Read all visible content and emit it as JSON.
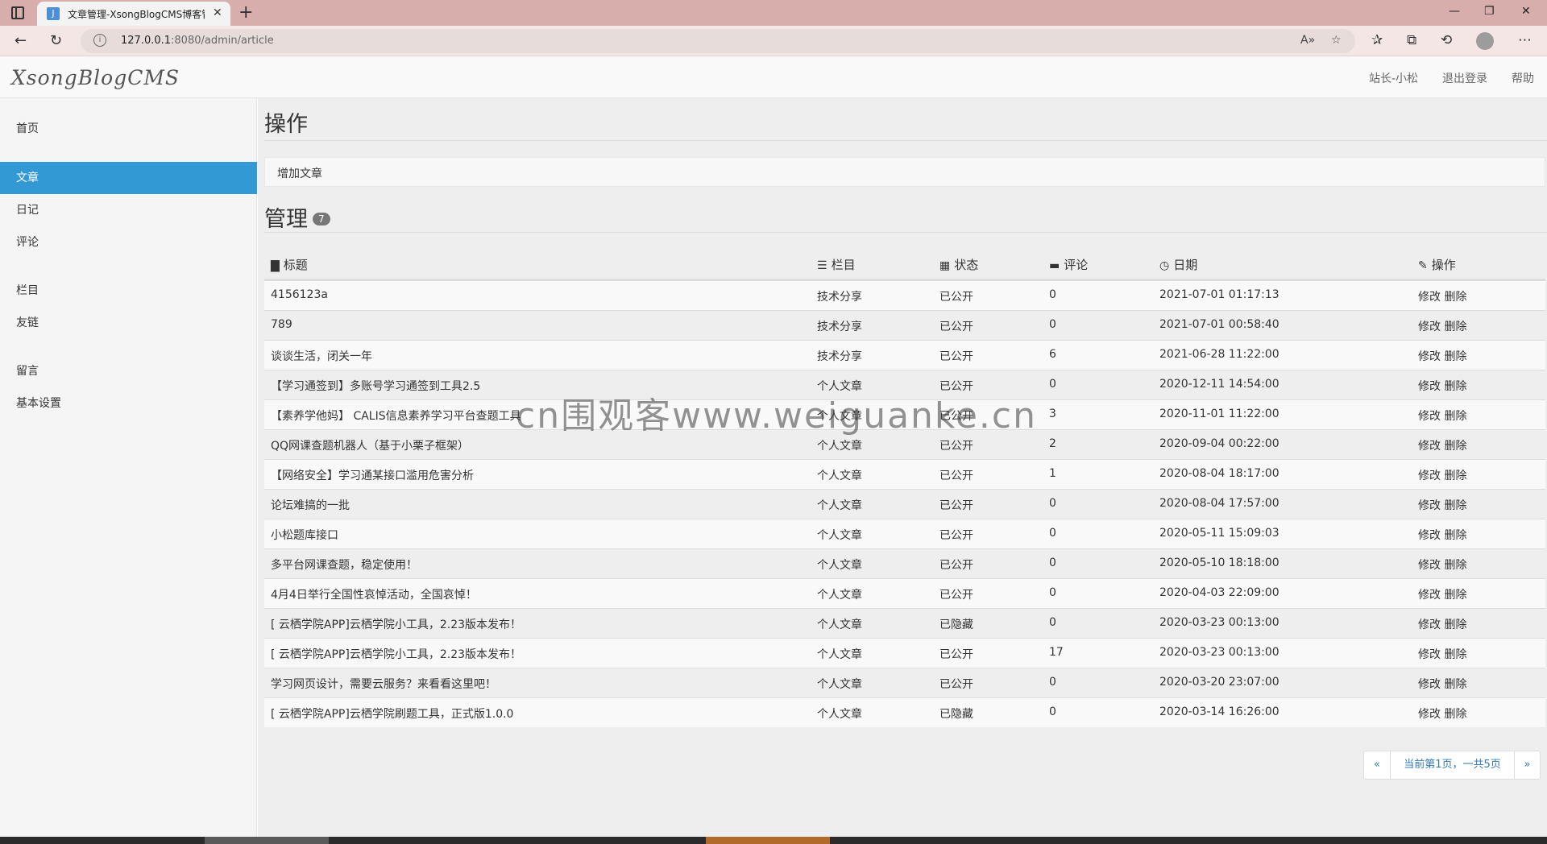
{
  "browser": {
    "tab_title": "文章管理-XsongBlogCMS博客管",
    "favicon_text": "J",
    "url_host": "127.0.0.1",
    "url_rest": ":8080/admin/article"
  },
  "app": {
    "brand": "XsongBlogCMS",
    "user_link": "站长-小松",
    "logout_link": "退出登录",
    "help_link": "帮助"
  },
  "sidebar": {
    "items": [
      {
        "label": "首页"
      },
      {
        "label": "文章",
        "active": true
      },
      {
        "label": "日记"
      },
      {
        "label": "评论"
      },
      {
        "label": "栏目"
      },
      {
        "label": "友链"
      },
      {
        "label": "留言"
      },
      {
        "label": "基本设置"
      }
    ]
  },
  "main": {
    "ops_title": "操作",
    "add_article": "增加文章",
    "manage_title": "管理",
    "manage_count": "7",
    "columns": {
      "title": "标题",
      "category": "栏目",
      "status": "状态",
      "comments": "评论",
      "date": "日期",
      "actions": "操作"
    },
    "edit_label": "修改",
    "delete_label": "删除",
    "rows": [
      {
        "title": "4156123a",
        "category": "技术分享",
        "status": "已公开",
        "comments": "0",
        "date": "2021-07-01 01:17:13"
      },
      {
        "title": "789",
        "category": "技术分享",
        "status": "已公开",
        "comments": "0",
        "date": "2021-07-01 00:58:40"
      },
      {
        "title": "谈谈生活，闭关一年",
        "category": "技术分享",
        "status": "已公开",
        "comments": "6",
        "date": "2021-06-28 11:22:00"
      },
      {
        "title": "【学习通签到】多账号学习通签到工具2.5",
        "category": "个人文章",
        "status": "已公开",
        "comments": "0",
        "date": "2020-12-11 14:54:00"
      },
      {
        "title": "【素养学他妈】 CALIS信息素养学习平台查题工具",
        "category": "个人文章",
        "status": "已公开",
        "comments": "3",
        "date": "2020-11-01 11:22:00"
      },
      {
        "title": "QQ网课查题机器人（基于小栗子框架）",
        "category": "个人文章",
        "status": "已公开",
        "comments": "2",
        "date": "2020-09-04 00:22:00"
      },
      {
        "title": "【网络安全】学习通某接口滥用危害分析",
        "category": "个人文章",
        "status": "已公开",
        "comments": "1",
        "date": "2020-08-04 18:17:00"
      },
      {
        "title": "论坛难搞的一批",
        "category": "个人文章",
        "status": "已公开",
        "comments": "0",
        "date": "2020-08-04 17:57:00"
      },
      {
        "title": "小松题库接口",
        "category": "个人文章",
        "status": "已公开",
        "comments": "0",
        "date": "2020-05-11 15:09:03"
      },
      {
        "title": "多平台网课查题，稳定使用！",
        "category": "个人文章",
        "status": "已公开",
        "comments": "0",
        "date": "2020-05-10 18:18:00"
      },
      {
        "title": "4月4日举行全国性哀悼活动，全国哀悼！",
        "category": "个人文章",
        "status": "已公开",
        "comments": "0",
        "date": "2020-04-03 22:09:00"
      },
      {
        "title": "[ 云栖学院APP]云栖学院小工具，2.23版本发布！",
        "category": "个人文章",
        "status": "已隐藏",
        "comments": "0",
        "date": "2020-03-23 00:13:00"
      },
      {
        "title": "[ 云栖学院APP]云栖学院小工具，2.23版本发布！",
        "category": "个人文章",
        "status": "已公开",
        "comments": "17",
        "date": "2020-03-23 00:13:00"
      },
      {
        "title": "学习网页设计，需要云服务？来看看这里吧！",
        "category": "个人文章",
        "status": "已公开",
        "comments": "0",
        "date": "2020-03-20 23:07:00"
      },
      {
        "title": "[ 云栖学院APP]云栖学院刷题工具，正式版1.0.0",
        "category": "个人文章",
        "status": "已隐藏",
        "comments": "0",
        "date": "2020-03-14 16:26:00"
      }
    ],
    "pager": {
      "prev": "«",
      "info": "当前第1页，一共5页",
      "next": "»"
    }
  },
  "watermark": "cn围观客www.weiguanke.cn"
}
